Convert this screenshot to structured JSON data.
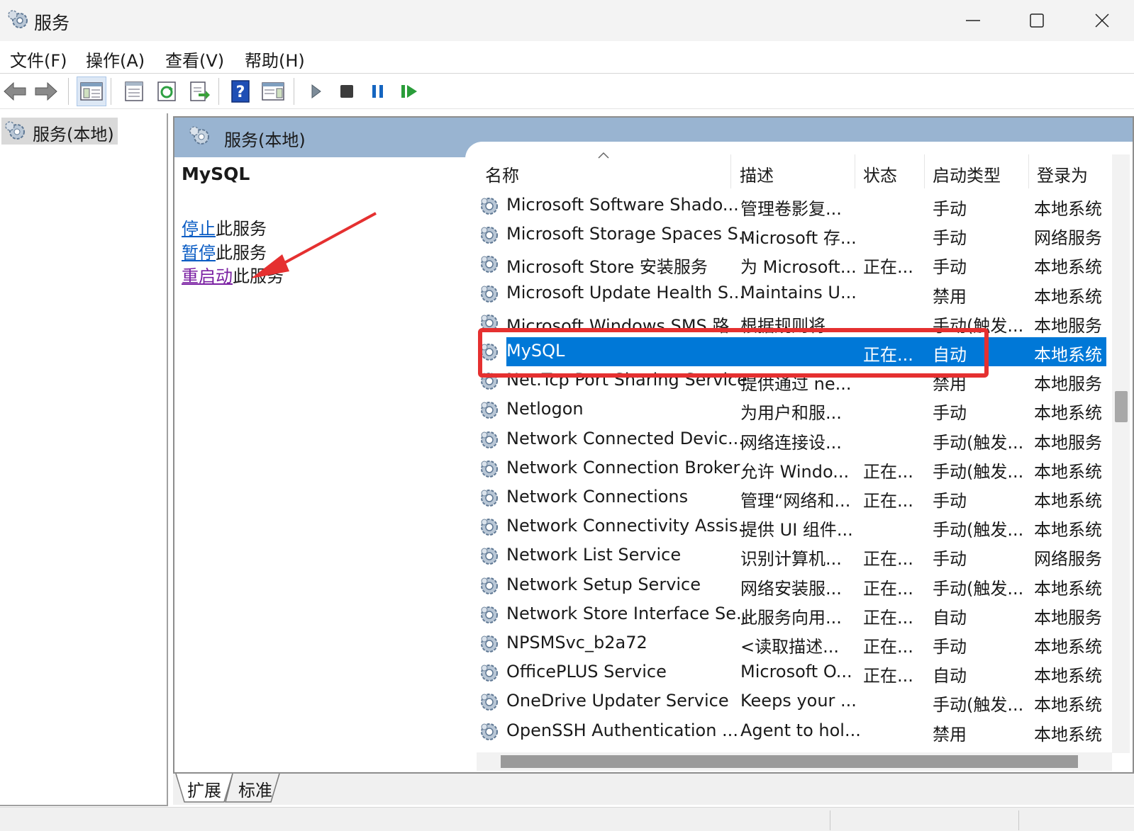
{
  "window": {
    "title": "服务",
    "controls": [
      "minimize",
      "maximize",
      "close"
    ]
  },
  "menu": [
    "文件(F)",
    "操作(A)",
    "查看(V)",
    "帮助(H)"
  ],
  "toolbar": {
    "icons": [
      "back-icon",
      "forward-icon",
      "show-hide-tree-icon",
      "properties-icon",
      "refresh-icon",
      "export-list-icon",
      "help-icon",
      "show-action-pane-icon",
      "start-service-icon",
      "stop-service-icon",
      "pause-service-icon",
      "resume-service-icon"
    ]
  },
  "tree": {
    "root_label": "服务(本地)"
  },
  "panel": {
    "header": "服务(本地)"
  },
  "detail": {
    "service_name": "MySQL",
    "actions": [
      {
        "link": "停止",
        "text": "此服务"
      },
      {
        "link": "暂停",
        "text": "此服务"
      },
      {
        "link": "重启动",
        "text": "此服务"
      }
    ]
  },
  "table": {
    "columns": [
      "名称",
      "描述",
      "状态",
      "启动类型",
      "登录为"
    ],
    "rows": [
      {
        "name": "Microsoft Software Shado...",
        "desc": "管理卷影复...",
        "status": "",
        "startup": "手动",
        "logon": "本地系统"
      },
      {
        "name": "Microsoft Storage Spaces S...",
        "desc": "Microsoft 存...",
        "status": "",
        "startup": "手动",
        "logon": "网络服务"
      },
      {
        "name": "Microsoft Store 安装服务",
        "desc": "为 Microsoft...",
        "status": "正在...",
        "startup": "手动",
        "logon": "本地系统"
      },
      {
        "name": "Microsoft Update Health S...",
        "desc": "Maintains U...",
        "status": "",
        "startup": "禁用",
        "logon": "本地系统"
      },
      {
        "name": "Microsoft Windows SMS 路...",
        "desc": "根据规则将...",
        "status": "",
        "startup": "手动(触发...",
        "logon": "本地服务"
      },
      {
        "name": "MySQL",
        "desc": "",
        "status": "正在...",
        "startup": "自动",
        "logon": "本地系统",
        "selected": true
      },
      {
        "name": "Net.Tcp Port Sharing Service",
        "desc": "提供通过 ne...",
        "status": "",
        "startup": "禁用",
        "logon": "本地服务"
      },
      {
        "name": "Netlogon",
        "desc": "为用户和服...",
        "status": "",
        "startup": "手动",
        "logon": "本地系统"
      },
      {
        "name": "Network Connected Devic...",
        "desc": "网络连接设...",
        "status": "",
        "startup": "手动(触发...",
        "logon": "本地服务"
      },
      {
        "name": "Network Connection Broker",
        "desc": "允许 Windo...",
        "status": "正在...",
        "startup": "手动(触发...",
        "logon": "本地系统"
      },
      {
        "name": "Network Connections",
        "desc": "管理“网络和...",
        "status": "正在...",
        "startup": "手动",
        "logon": "本地系统"
      },
      {
        "name": "Network Connectivity Assis...",
        "desc": "提供 UI 组件...",
        "status": "",
        "startup": "手动(触发...",
        "logon": "本地系统"
      },
      {
        "name": "Network List Service",
        "desc": "识别计算机...",
        "status": "正在...",
        "startup": "手动",
        "logon": "网络服务"
      },
      {
        "name": "Network Setup Service",
        "desc": "网络安装服...",
        "status": "正在...",
        "startup": "手动(触发...",
        "logon": "本地系统"
      },
      {
        "name": "Network Store Interface Se...",
        "desc": "此服务向用...",
        "status": "正在...",
        "startup": "自动",
        "logon": "本地服务"
      },
      {
        "name": "NPSMSvc_b2a72",
        "desc": "<读取描述...",
        "status": "正在...",
        "startup": "手动",
        "logon": "本地系统"
      },
      {
        "name": "OfficePLUS Service",
        "desc": "Microsoft O...",
        "status": "正在...",
        "startup": "自动",
        "logon": "本地系统"
      },
      {
        "name": "OneDrive Updater Service",
        "desc": "Keeps your ...",
        "status": "",
        "startup": "手动(触发...",
        "logon": "本地系统"
      },
      {
        "name": "OpenSSH Authentication ...",
        "desc": "Agent to hol...",
        "status": "",
        "startup": "禁用",
        "logon": "本地系统"
      }
    ]
  },
  "bottom_tabs": [
    "扩展",
    "标准"
  ],
  "colors": {
    "selection": "#0078d7",
    "panel_header": "#99b4d1",
    "highlight_box": "#e53030",
    "link": "#0a5cc4",
    "visited_link": "#7a1fa2"
  }
}
